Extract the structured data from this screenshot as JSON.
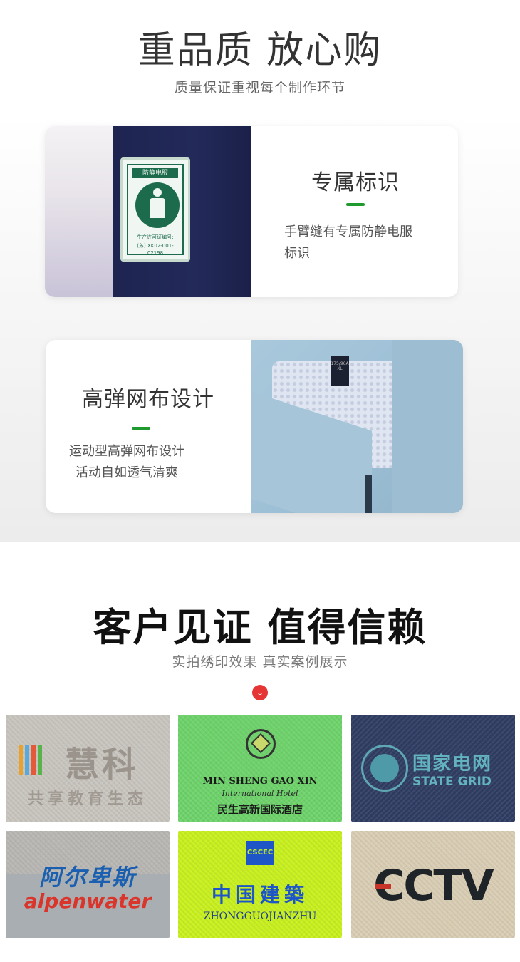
{
  "quality": {
    "title": "重品质 放心购",
    "subtitle": "质量保证重视每个制作环节",
    "features": [
      {
        "title": "专属标识",
        "desc_line1": "手臂缝有专属防静电服",
        "desc_line2": "标识",
        "badge": {
          "top": "防静电服",
          "license_label": "生产许可证编号:",
          "license_no": "(苏) XK02-001-02198"
        }
      },
      {
        "title": "高弹网布设计",
        "desc_line1": "运动型高弹网布设计",
        "desc_line2": "活动自如透气清爽",
        "tag": "175/96A XL"
      }
    ]
  },
  "customers": {
    "title": "客户见证 值得信赖",
    "subtitle": "实拍绣印效果 真实案例展示",
    "chevron_icon": "chevron-down-icon",
    "samples": [
      {
        "name": "huike",
        "logo": "慧科",
        "line2": "共享教育生态",
        "bg": "#c8c4be"
      },
      {
        "name": "minsheng",
        "logo": "MIN SHENG GAO XIN",
        "line2": "International Hotel",
        "line3": "民生高新国际酒店",
        "bg": "#6ed36b"
      },
      {
        "name": "state-grid",
        "logo": "国家电网",
        "line2": "STATE GRID",
        "bg": "#2f3d63"
      },
      {
        "name": "alpenwater",
        "logo": "阿尔卑斯",
        "line2": "alpenwater",
        "bg": "#b9b7b4"
      },
      {
        "name": "cscec",
        "logo": "中国建築",
        "line2": "ZHONGGUOJIANZHU",
        "badge": "CSCEC",
        "bg": "#c8f01e"
      },
      {
        "name": "cctv",
        "logo": "CCTV",
        "bg": "#d9cdb4"
      }
    ]
  },
  "colors": {
    "accent_green": "#1e9a2e",
    "chevron_red": "#e53535"
  }
}
